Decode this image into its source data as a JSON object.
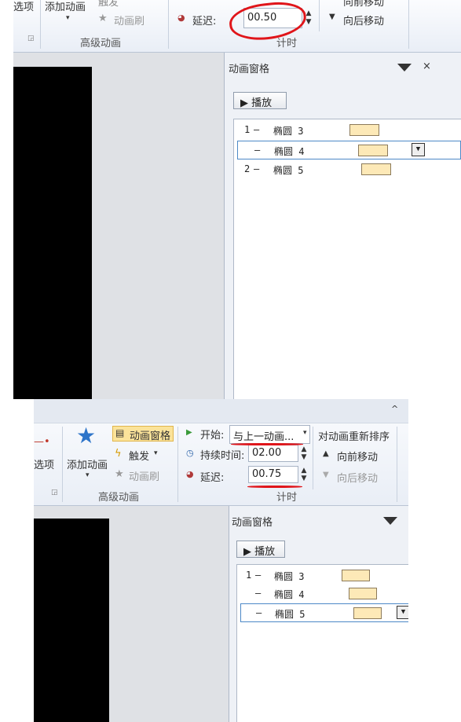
{
  "top": {
    "ribbon": {
      "options_label": "选项",
      "add_animation_label": "添加动画",
      "add_animation_caret": "▾",
      "trigger_label": "触发",
      "animation_painter_label": "动画刷",
      "advanced_group_label": "高级动画",
      "delay_label": "延迟:",
      "delay_value": "00.50",
      "move_later_label": "向后移动",
      "move_earlier_partial": "向前移动",
      "timing_group_label": "计时",
      "corner_glyph": "◲"
    },
    "pane": {
      "title": "动画窗格",
      "close": "×",
      "play_label": "播放",
      "rows": [
        {
          "index": "1",
          "dash": "—",
          "name": "椭圆 3"
        },
        {
          "index": "",
          "dash": "—",
          "name": "椭圆 4"
        },
        {
          "index": "2",
          "dash": "—",
          "name": "椭圆 5"
        }
      ]
    }
  },
  "bottom": {
    "ribbon": {
      "options_label": "选项",
      "add_animation_label": "添加动画",
      "add_animation_caret": "▾",
      "animation_pane_label": "动画窗格",
      "trigger_label": "触发",
      "trigger_caret": "▾",
      "animation_painter_label": "动画刷",
      "advanced_group_label": "高级动画",
      "start_label": "开始:",
      "start_value": "与上一动画...",
      "duration_label": "持续时间:",
      "duration_value": "02.00",
      "delay_label": "延迟:",
      "delay_value": "00.75",
      "reorder_label": "对动画重新排序",
      "move_earlier_label": "向前移动",
      "move_later_label": "向后移动",
      "timing_group_label": "计时",
      "collapse_glyph": "^",
      "corner_glyph": "◲"
    },
    "pane": {
      "title": "动画窗格",
      "play_label": "播放",
      "rows": [
        {
          "index": "1",
          "dash": "—",
          "name": "椭圆 3"
        },
        {
          "index": "",
          "dash": "—",
          "name": "椭圆 4"
        },
        {
          "index": "",
          "dash": "—",
          "name": "椭圆 5"
        }
      ]
    }
  },
  "colors": {
    "annotation_red": "#e0151a",
    "timing_bar": "#fde9b7",
    "selection_border": "#4d89c7"
  }
}
